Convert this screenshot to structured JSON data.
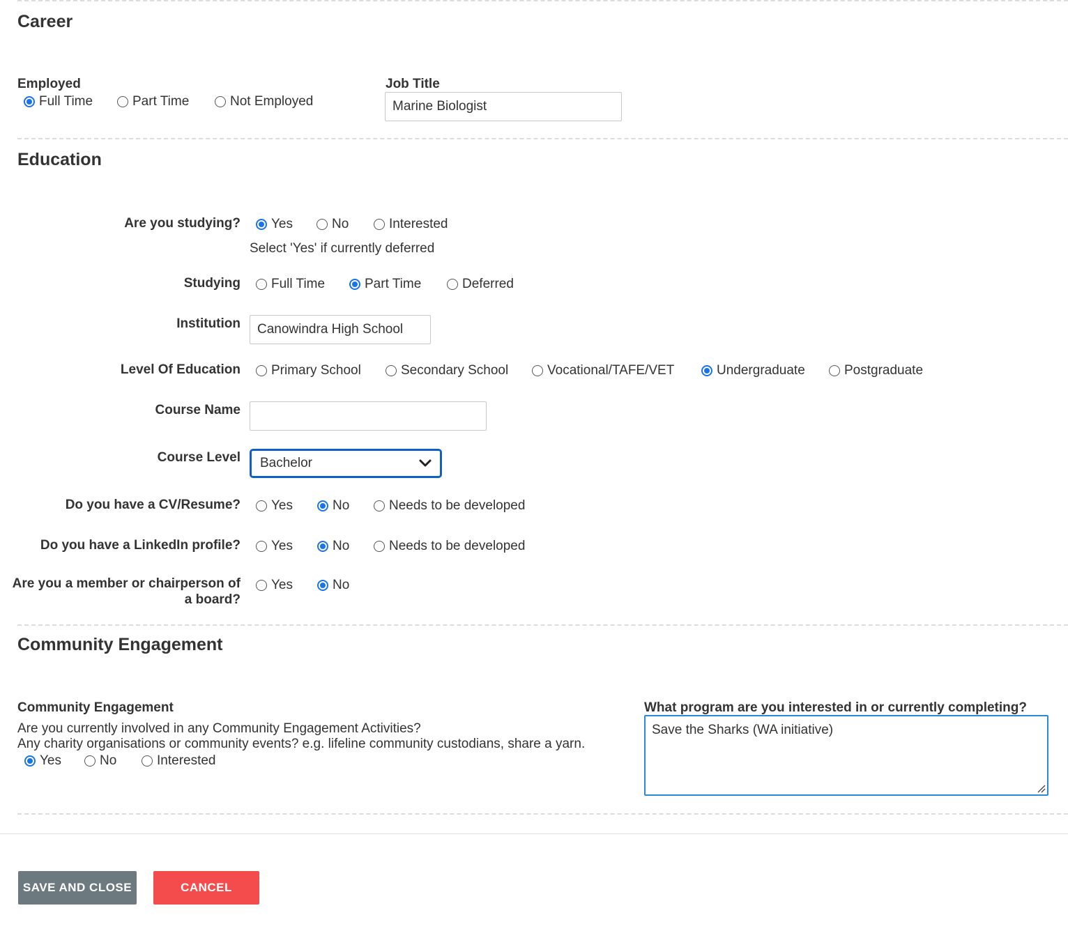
{
  "career": {
    "title": "Career",
    "employed": {
      "label": "Employed",
      "options": [
        "Full Time",
        "Part Time",
        "Not Employed"
      ],
      "selected": "Full Time"
    },
    "job_title": {
      "label": "Job Title",
      "value": "Marine Biologist"
    }
  },
  "education": {
    "title": "Education",
    "studying_q": {
      "label": "Are you studying?",
      "options": [
        "Yes",
        "No",
        "Interested"
      ],
      "selected": "Yes",
      "hint": "Select 'Yes' if currently deferred"
    },
    "studying": {
      "label": "Studying",
      "options": [
        "Full Time",
        "Part Time",
        "Deferred"
      ],
      "selected": "Part Time"
    },
    "institution": {
      "label": "Institution",
      "value": "Canowindra High School"
    },
    "level": {
      "label": "Level Of Education",
      "options": [
        "Primary School",
        "Secondary School",
        "Vocational/TAFE/VET",
        "Undergraduate",
        "Postgraduate"
      ],
      "selected": "Undergraduate"
    },
    "course_name": {
      "label": "Course Name",
      "value": ""
    },
    "course_level": {
      "label": "Course Level",
      "value": "Bachelor"
    },
    "cv": {
      "label": "Do you have a CV/Resume?",
      "options": [
        "Yes",
        "No",
        "Needs to be developed"
      ],
      "selected": "No"
    },
    "linkedin": {
      "label": "Do you have a LinkedIn profile?",
      "options": [
        "Yes",
        "No",
        "Needs to be developed"
      ],
      "selected": "No"
    },
    "board": {
      "label_line1": "Are you a member or chairperson of",
      "label_line2": "a board?",
      "options": [
        "Yes",
        "No"
      ],
      "selected": "No"
    }
  },
  "community": {
    "title": "Community Engagement",
    "engagement": {
      "label": "Community Engagement",
      "desc_line1": "Are you currently involved in any Community Engagement Activities?",
      "desc_line2": "Any charity organisations or community events? e.g. lifeline community custodians, share a yarn.",
      "options": [
        "Yes",
        "No",
        "Interested"
      ],
      "selected": "Yes"
    },
    "program": {
      "label": "What program are you interested in or currently completing?",
      "value": "Save the Sharks (WA initiative)"
    }
  },
  "actions": {
    "save_label": "SAVE AND CLOSE",
    "cancel_label": "CANCEL",
    "save_color": "#6c7a80",
    "cancel_color": "#f44c4c"
  },
  "colors": {
    "accent": "#1a73e8"
  }
}
